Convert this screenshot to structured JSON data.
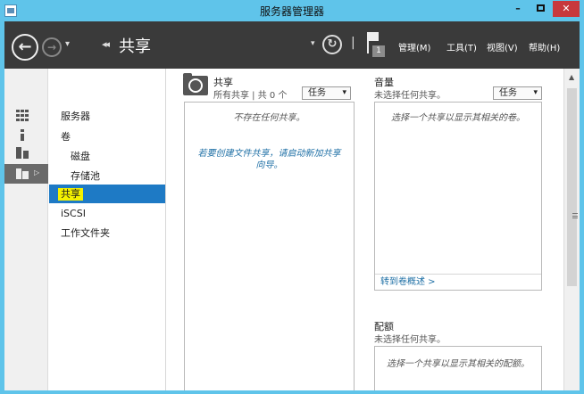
{
  "window": {
    "title": "服务器管理器",
    "min_glyph": "–",
    "close_glyph": "✕"
  },
  "header": {
    "back_glyph": "←",
    "forward_glyph": "→",
    "dropdown_glyph": "▾",
    "breadcrumb_arrows": "◂◂",
    "breadcrumb": "共享",
    "refresh_glyph": "↻",
    "separator": "|",
    "notification_count": "1",
    "menus": [
      "管理(M)",
      "工具(T)",
      "视图(V)",
      "帮助(H)"
    ]
  },
  "rail": {
    "items": [
      "dashboard-icon",
      "local-server-icon",
      "all-servers-icon",
      "file-storage-icon"
    ],
    "expand_glyph": "▷"
  },
  "tree": {
    "items": [
      "服务器",
      "卷",
      "磁盘",
      "存储池",
      "共享",
      "iSCSI",
      "工作文件夹"
    ],
    "selected": "共享"
  },
  "shares": {
    "title": "共享",
    "subtitle": "所有共享 | 共 0 个",
    "tasks_label": "任务",
    "empty_message": "不存在任何共享。",
    "create_message_line1": "若要创建文件共享，请启动新加共享",
    "create_message_line2": "向导。"
  },
  "volume": {
    "title": "音量",
    "subtitle": "未选择任何共享。",
    "tasks_label": "任务",
    "empty_message": "选择一个共享以显示其相关的卷。",
    "link": "转到卷概述 >"
  },
  "quota": {
    "title": "配额",
    "subtitle": "未选择任何共享。",
    "empty_message": "选择一个共享以显示其相关的配额。"
  },
  "colors": {
    "titlebar": "#5fc4ea",
    "header": "#3a3a3a",
    "selection": "#1e7ac5",
    "highlight": "#f5f200",
    "link": "#1e6fa5",
    "close_button": "#c7383c"
  }
}
